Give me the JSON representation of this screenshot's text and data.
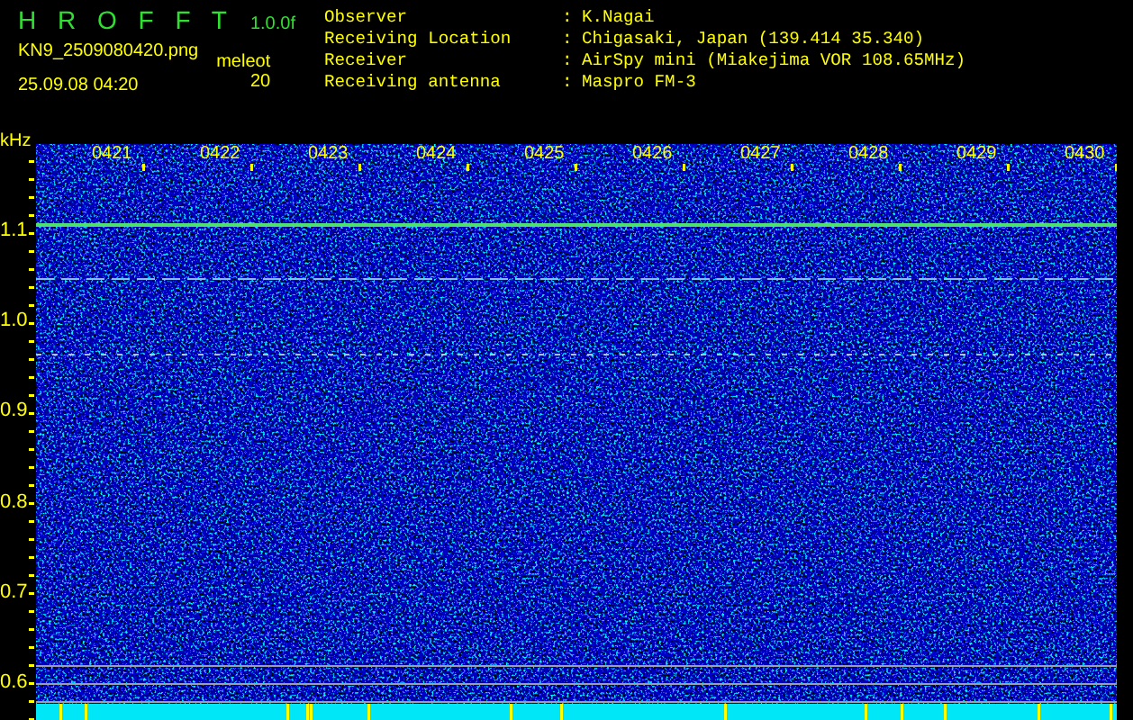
{
  "header": {
    "title": "H R O F F T",
    "version": "1.0.0f",
    "filename": "KN9_2509080420.png",
    "timestamp": "25.09.08 04:20",
    "mode_label": "meleot",
    "mode_value": "20"
  },
  "station_info": [
    {
      "label": "Observer",
      "separator": ":",
      "value": "K.Nagai"
    },
    {
      "label": "Receiving Location",
      "separator": ":",
      "value": "Chigasaki, Japan (139.414 35.340)"
    },
    {
      "label": "Receiver",
      "separator": ":",
      "value": "AirSpy mini (Miakejima VOR 108.65MHz)"
    },
    {
      "label": "Receiving antenna",
      "separator": ":",
      "value": "Maspro FM-3"
    }
  ],
  "spectrogram": {
    "y_unit": "kHz",
    "y_labels": [
      "1.1",
      "1.0",
      "0.9",
      "0.8",
      "0.7",
      "0.6"
    ],
    "time_labels": [
      "0421",
      "0422",
      "0423",
      "0424",
      "0425",
      "0426",
      "0427",
      "0428",
      "0429",
      "0430"
    ]
  }
}
